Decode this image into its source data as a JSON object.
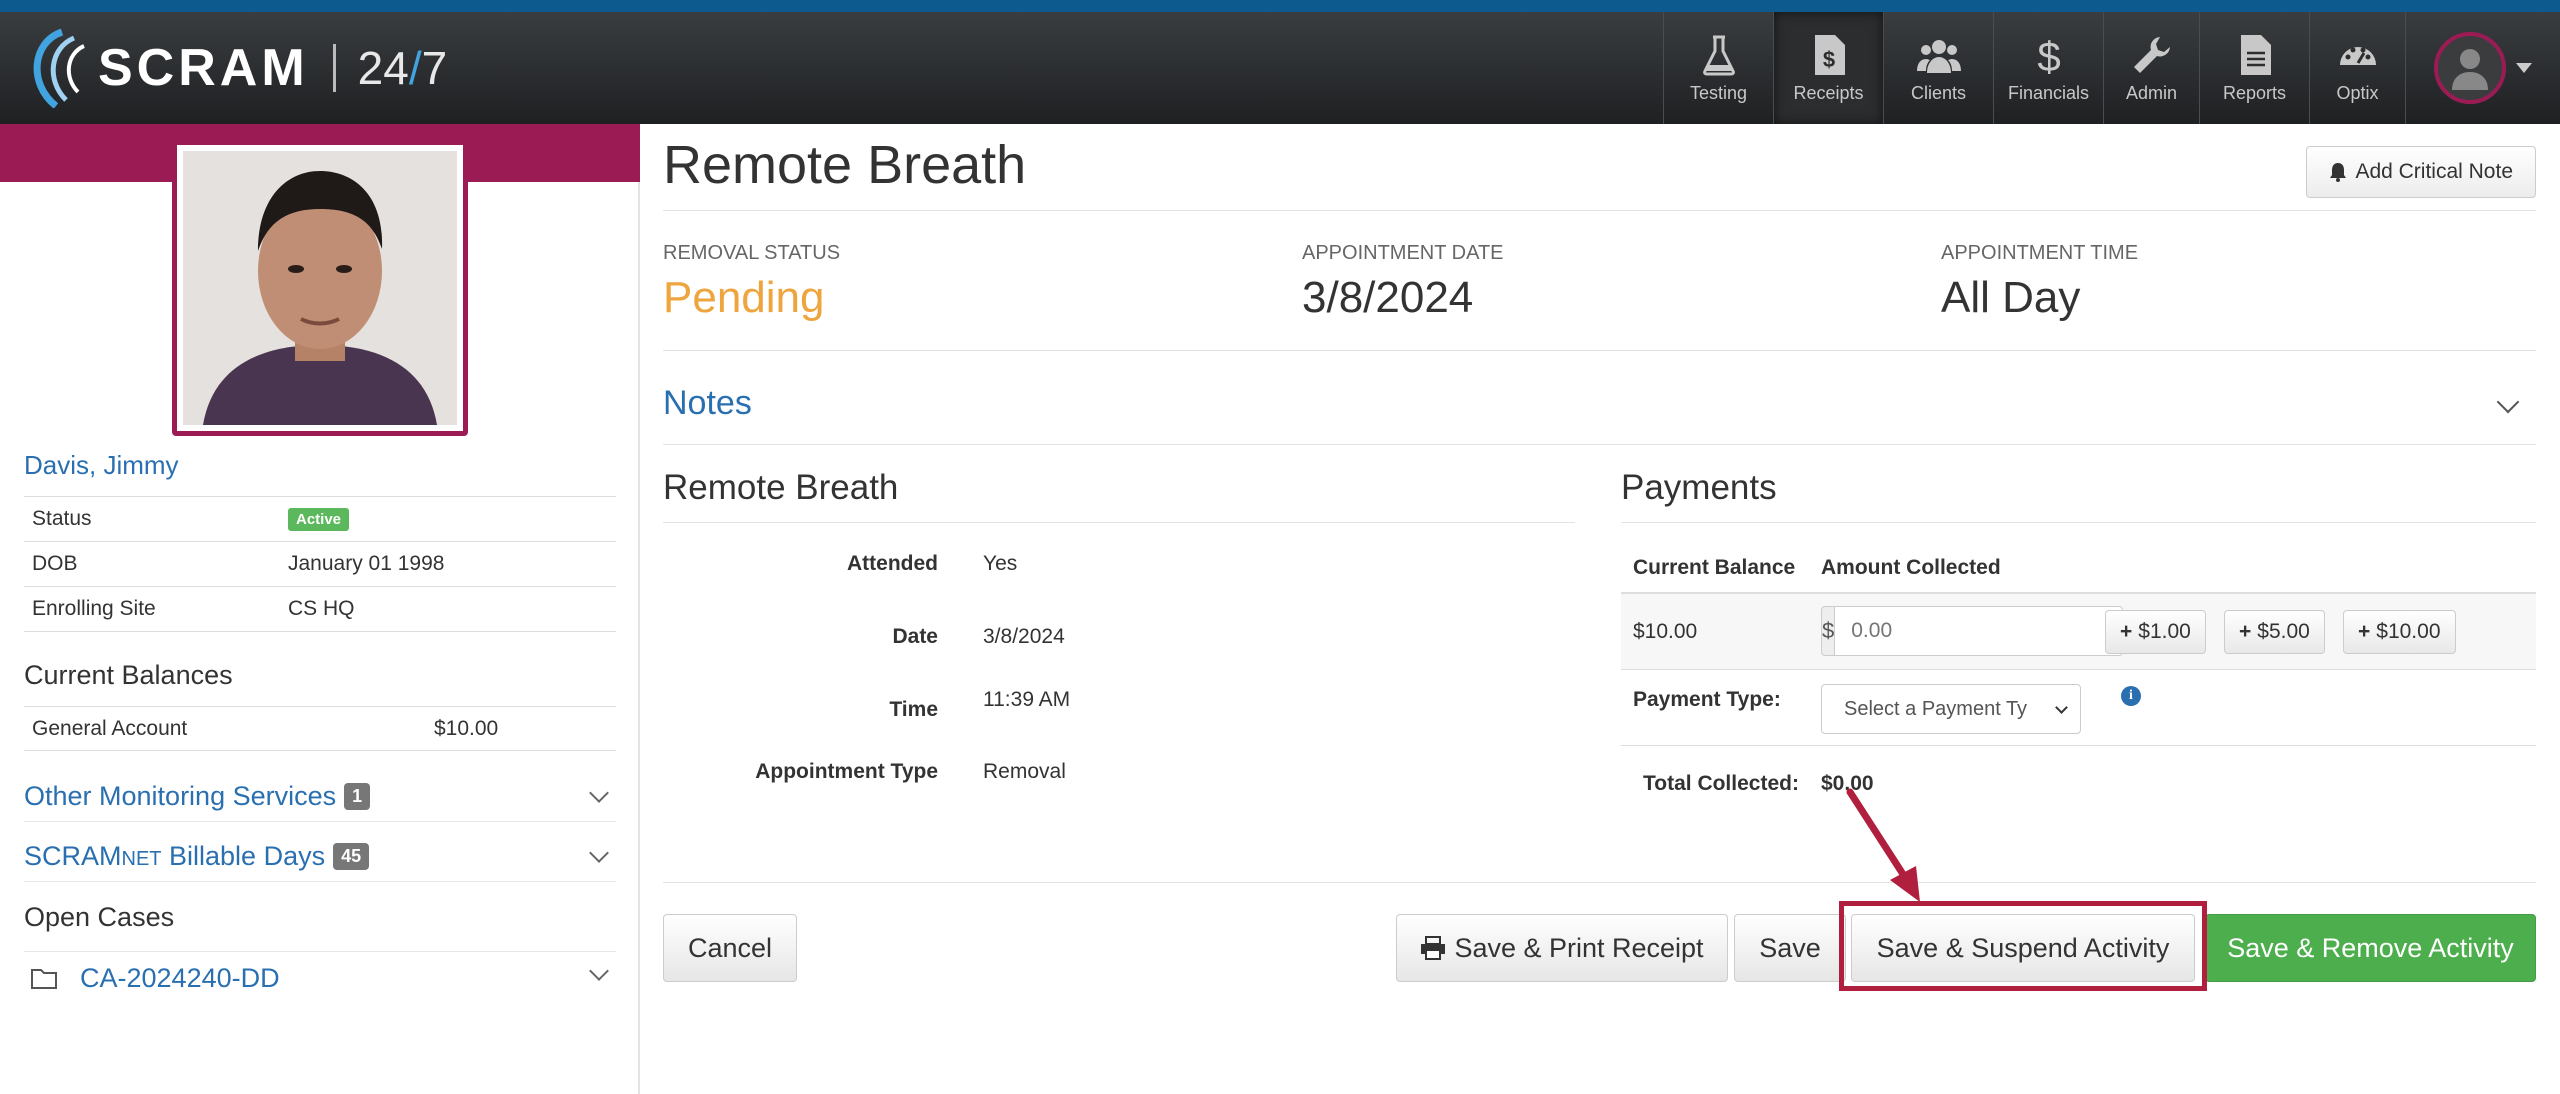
{
  "brand": {
    "name": "SCRAM",
    "suffix_a": "24",
    "suffix_slash": "/",
    "suffix_b": "7"
  },
  "nav": [
    {
      "label": "Testing",
      "icon": "flask-icon",
      "active": false
    },
    {
      "label": "Receipts",
      "icon": "receipt-icon",
      "active": true
    },
    {
      "label": "Clients",
      "icon": "users-icon",
      "active": false
    },
    {
      "label": "Financials",
      "icon": "dollar-icon",
      "active": false
    },
    {
      "label": "Admin",
      "icon": "wrench-icon",
      "active": false
    },
    {
      "label": "Reports",
      "icon": "document-icon",
      "active": false
    },
    {
      "label": "Optix",
      "icon": "dashboard-icon",
      "active": false
    }
  ],
  "client": {
    "name": "Davis, Jimmy",
    "info": [
      {
        "label": "Status",
        "value": "Active"
      },
      {
        "label": "DOB",
        "value": "January 01 1998"
      },
      {
        "label": "Enrolling Site",
        "value": "CS HQ"
      }
    ],
    "balances_title": "Current Balances",
    "balances": [
      {
        "label": "General Account",
        "value": "$10.00"
      }
    ],
    "other_services": {
      "label": "Other Monitoring Services",
      "count": "1"
    },
    "billable_days": {
      "label_a": "SCRAM",
      "label_b": "NET",
      "label_c": " Billable Days",
      "count": "45"
    },
    "open_cases_title": "Open Cases",
    "case": "CA-2024240-DD"
  },
  "main": {
    "title": "Remote Breath",
    "critical_note_label": "Add Critical Note",
    "stats": [
      {
        "label": "REMOVAL STATUS",
        "value": "Pending"
      },
      {
        "label": "APPOINTMENT DATE",
        "value": "3/8/2024"
      },
      {
        "label": "APPOINTMENT TIME",
        "value": "All Day"
      }
    ],
    "notes_label": "Notes",
    "details_title": "Remote Breath",
    "details": [
      {
        "label": "Attended",
        "value": "Yes"
      },
      {
        "label": "Date",
        "value": "3/8/2024"
      },
      {
        "label": "Time",
        "value": "11:39 AM"
      },
      {
        "label": "Appointment Type",
        "value": "Removal"
      }
    ],
    "payments": {
      "title": "Payments",
      "col_balance": "Current Balance",
      "col_amount": "Amount Collected",
      "balance": "$10.00",
      "currency": "$",
      "amount_placeholder": "0.00",
      "quick_amounts": [
        "$1.00",
        "$5.00",
        "$10.00"
      ],
      "payment_type_label": "Payment Type:",
      "payment_type_selected": "Select a Payment Ty",
      "total_label": "Total Collected:",
      "total_value": "$0.00"
    },
    "actions": {
      "cancel": "Cancel",
      "save_print": "Save & Print Receipt",
      "save": "Save",
      "save_suspend": "Save & Suspend Activity",
      "save_remove": "Save & Remove Activity"
    }
  },
  "colors": {
    "brand_magenta": "#9b1c55",
    "link_blue": "#2a6fb0",
    "pending_orange": "#eea53e",
    "success_green": "#4cae4c",
    "annotation_red": "#b11f3e"
  }
}
